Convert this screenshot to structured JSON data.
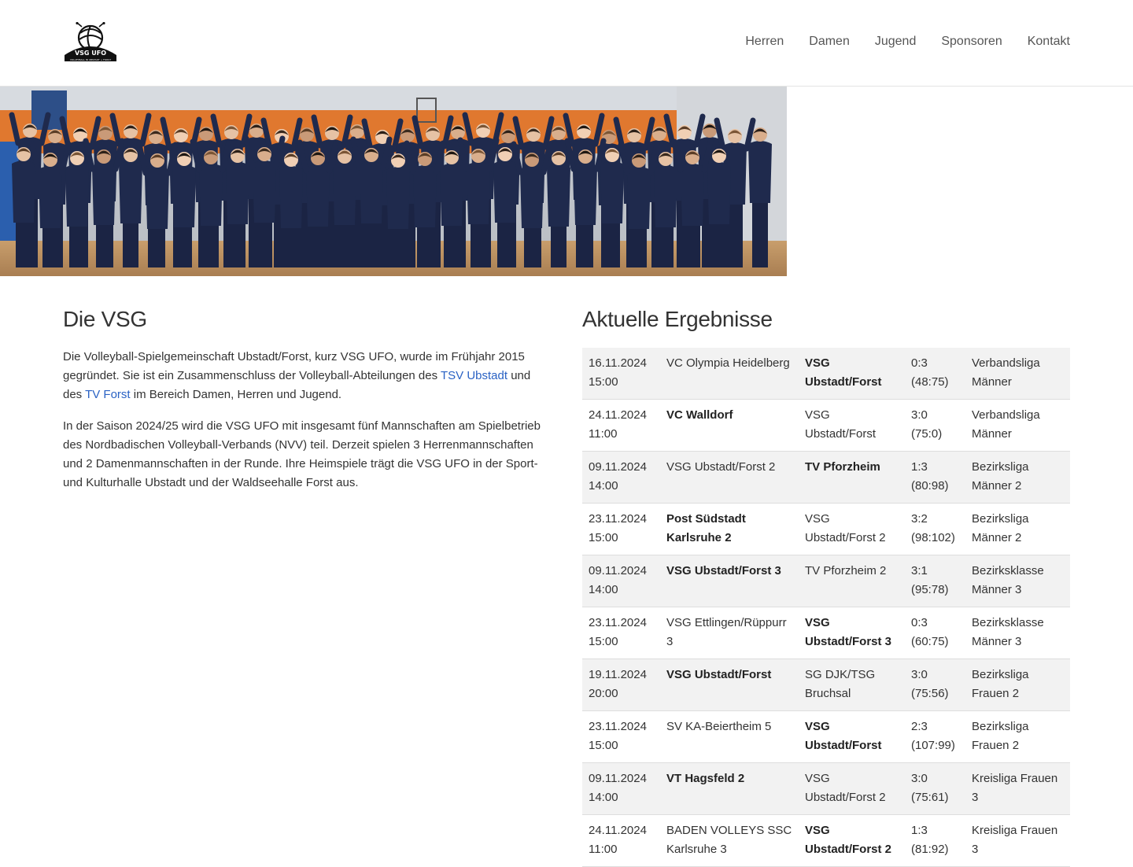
{
  "brand": {
    "logo_alt": "VSG UFO",
    "logo_text": "VSG UFO",
    "logo_tagline": "VOLLEYBALL IN UBSTADT + FORST"
  },
  "nav": [
    "Herren",
    "Damen",
    "Jugend",
    "Sponsoren",
    "Kontakt"
  ],
  "about": {
    "title": "Die VSG",
    "p1_a": "Die Volleyball-Spielgemeinschaft Ubstadt/Forst, kurz VSG UFO, wurde im Frühjahr 2015 gegründet. Sie ist ein Zusammenschluss der Volleyball-Abteilungen des ",
    "p1_link1": "TSV Ubstadt",
    "p1_b": " und des ",
    "p1_link2": "TV Forst",
    "p1_c": " im Bereich Damen, Herren und Jugend.",
    "p2": "In der Saison 2024/25 wird die VSG UFO mit insgesamt fünf Mannschaften am Spielbetrieb des Nordbadischen Volleyball-Verbands (NVV) teil. Derzeit spielen 3 Herrenmannschaften und 2 Damenmannschaften in der Runde. Ihre Heimspiele trägt die VSG UFO in der Sport- und Kulturhalle Ubstadt und der Waldseehalle Forst aus."
  },
  "results": {
    "title": "Aktuelle Ergebnisse",
    "rows": [
      {
        "date": "16.11.2024 15:00",
        "home": "VC Olympia Heidelberg",
        "away": "VSG Ubstadt/Forst",
        "score": "0:3 (48:75)",
        "league": "Verbandsliga Männer",
        "winner": "away"
      },
      {
        "date": "24.11.2024 11:00",
        "home": "VC Walldorf",
        "away": "VSG Ubstadt/Forst",
        "score": "3:0 (75:0)",
        "league": "Verbandsliga Männer",
        "winner": "home"
      },
      {
        "date": "09.11.2024 14:00",
        "home": "VSG Ubstadt/Forst 2",
        "away": "TV Pforzheim",
        "score": "1:3 (80:98)",
        "league": "Bezirksliga Männer 2",
        "winner": "away"
      },
      {
        "date": "23.11.2024 15:00",
        "home": "Post Südstadt Karlsruhe 2",
        "away": "VSG Ubstadt/Forst 2",
        "score": "3:2 (98:102)",
        "league": "Bezirksliga Männer 2",
        "winner": "home"
      },
      {
        "date": "09.11.2024 14:00",
        "home": "VSG Ubstadt/Forst 3",
        "away": "TV Pforzheim 2",
        "score": "3:1 (95:78)",
        "league": "Bezirksklasse Männer 3",
        "winner": "home"
      },
      {
        "date": "23.11.2024 15:00",
        "home": "VSG Ettlingen/Rüppurr 3",
        "away": "VSG Ubstadt/Forst 3",
        "score": "0:3 (60:75)",
        "league": "Bezirksklasse Männer 3",
        "winner": "away"
      },
      {
        "date": "19.11.2024 20:00",
        "home": "VSG Ubstadt/Forst",
        "away": "SG DJK/TSG Bruchsal",
        "score": "3:0 (75:56)",
        "league": "Bezirksliga Frauen 2",
        "winner": "home"
      },
      {
        "date": "23.11.2024 15:00",
        "home": "SV KA-Beiertheim 5",
        "away": "VSG Ubstadt/Forst",
        "score": "2:3 (107:99)",
        "league": "Bezirksliga Frauen 2",
        "winner": "away"
      },
      {
        "date": "09.11.2024 14:00",
        "home": "VT Hagsfeld 2",
        "away": "VSG Ubstadt/Forst 2",
        "score": "3:0 (75:61)",
        "league": "Kreisliga Frauen 3",
        "winner": "home"
      },
      {
        "date": "24.11.2024 11:00",
        "home": "BADEN VOLLEYS SSC Karlsruhe 3",
        "away": "VSG Ubstadt/Forst 2",
        "score": "1:3 (81:92)",
        "league": "Kreisliga Frauen 3",
        "winner": "away"
      }
    ]
  },
  "colors": {
    "link": "#2a62c4",
    "text": "#333333",
    "row_stripe": "#f2f2f2"
  }
}
